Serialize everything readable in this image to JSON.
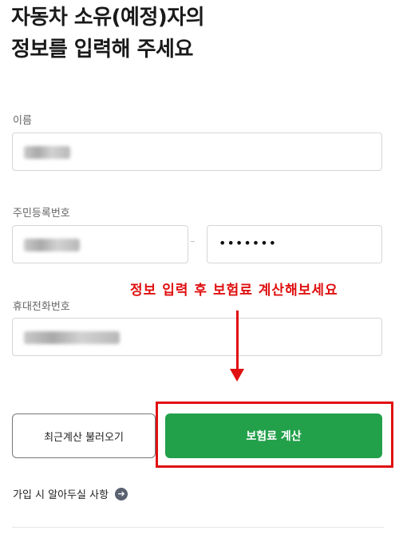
{
  "header": {
    "title_line1": "자동차 소유(예정)자의",
    "title_line2": "정보를 입력해 주세요"
  },
  "form": {
    "name_label": "이름",
    "rrn_label": "주민등록번호",
    "rrn_separator": "–",
    "rrn_back_masked": "•••••••",
    "phone_label": "휴대전화번호"
  },
  "annotation": {
    "text": "정보 입력 후 보험료 계산해보세요",
    "color": "#e01010"
  },
  "buttons": {
    "recent_label": "최근계산 불러오기",
    "calculate_label": "보험료 계산",
    "primary_color": "#22a04a"
  },
  "footer": {
    "info_link_label": "가입 시 알아두실 사항",
    "info_link_icon": "arrow-right-circle-icon"
  }
}
